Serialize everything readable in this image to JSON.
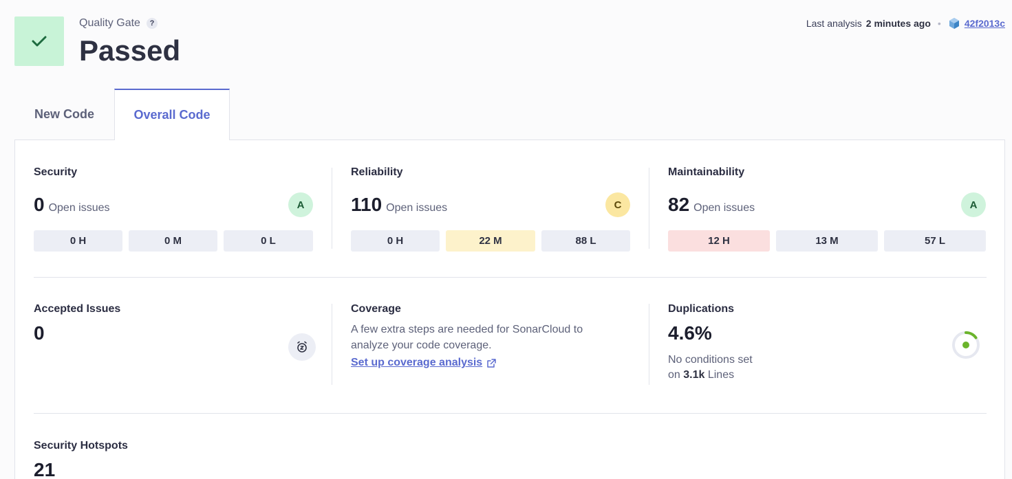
{
  "header": {
    "quality_gate_label": "Quality Gate",
    "help_glyph": "?",
    "status": "Passed",
    "status_icon": "check-icon",
    "last_analysis_prefix": "Last analysis",
    "last_analysis_time": "2 minutes ago",
    "commit_icon": "cube-icon",
    "commit_hash": "42f2013c"
  },
  "tabs": [
    {
      "label": "New Code",
      "active": false
    },
    {
      "label": "Overall Code",
      "active": true
    }
  ],
  "security": {
    "title": "Security",
    "count": "0",
    "suffix": "Open issues",
    "rating": "A",
    "severities": [
      "0 H",
      "0 M",
      "0 L"
    ]
  },
  "reliability": {
    "title": "Reliability",
    "count": "110",
    "suffix": "Open issues",
    "rating": "C",
    "severities": [
      "0 H",
      "22 M",
      "88 L"
    ]
  },
  "maintainability": {
    "title": "Maintainability",
    "count": "82",
    "suffix": "Open issues",
    "rating": "A",
    "severities": [
      "12 H",
      "13 M",
      "57 L"
    ]
  },
  "accepted": {
    "title": "Accepted Issues",
    "count": "0",
    "icon": "alarm-snooze-icon"
  },
  "coverage": {
    "title": "Coverage",
    "text": "A few extra steps are needed for SonarCloud to analyze your code coverage.",
    "link": "Set up coverage analysis",
    "link_icon": "external-link-icon"
  },
  "duplications": {
    "title": "Duplications",
    "value": "4.6%",
    "conditions": "No conditions set",
    "on": "on",
    "lines_count": "3.1k",
    "lines_label": "Lines",
    "indicator_color": "#6bb42c"
  },
  "hotspots": {
    "title": "Security Hotspots",
    "count": "21"
  },
  "colors": {
    "accent": "#5a6acf",
    "passed_bg": "#c8f3d7",
    "passed_check": "#1e6b3f"
  }
}
